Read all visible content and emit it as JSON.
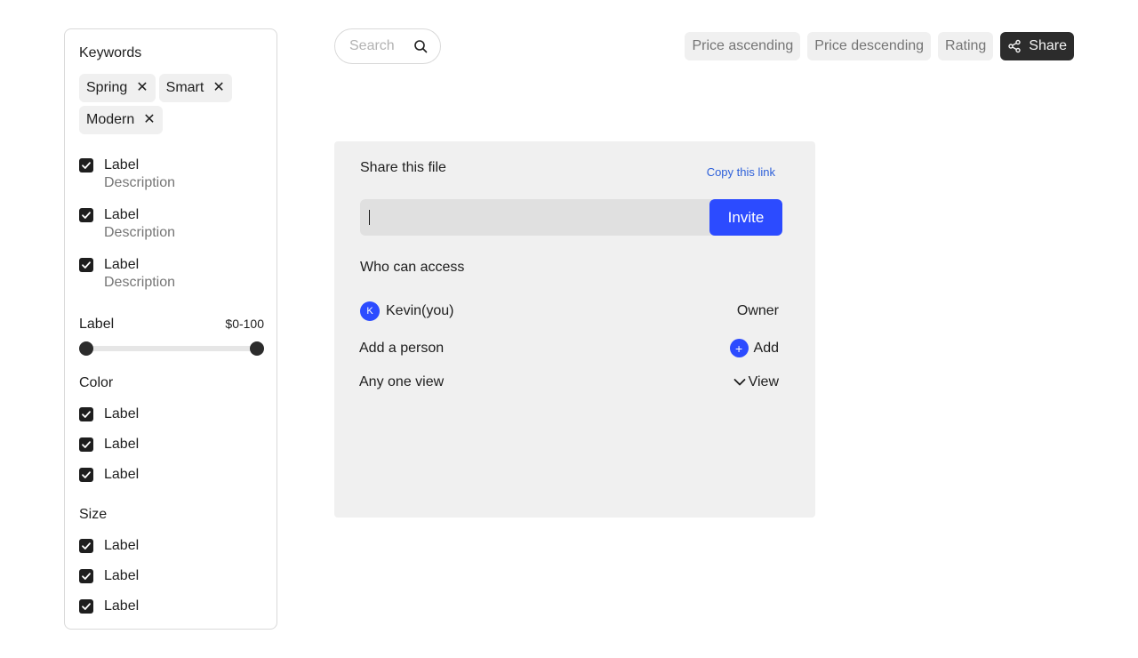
{
  "filters": {
    "keywords_title": "Keywords",
    "keywords": [
      {
        "label": "Spring"
      },
      {
        "label": "Smart"
      },
      {
        "label": "Modern"
      }
    ],
    "checklist": [
      {
        "label": "Label",
        "description": "Description",
        "checked": true
      },
      {
        "label": "Label",
        "description": "Description",
        "checked": true
      },
      {
        "label": "Label",
        "description": "Description",
        "checked": true
      }
    ],
    "range": {
      "label": "Label",
      "value_text": "$0-100",
      "min": 0,
      "max": 100
    },
    "color": {
      "title": "Color",
      "items": [
        {
          "label": "Label",
          "checked": true
        },
        {
          "label": "Label",
          "checked": true
        },
        {
          "label": "Label",
          "checked": true
        }
      ]
    },
    "size": {
      "title": "Size",
      "items": [
        {
          "label": "Label",
          "checked": true
        },
        {
          "label": "Label",
          "checked": true
        },
        {
          "label": "Label",
          "checked": true
        }
      ]
    }
  },
  "toolbar": {
    "search_placeholder": "Search",
    "sort_buttons": [
      "Price ascending",
      "Price descending",
      "Rating"
    ],
    "share_label": "Share"
  },
  "share_dialog": {
    "title": "Share this file",
    "copy_link": "Copy this link",
    "input_value": "",
    "invite_label": "Invite",
    "access_title": "Who can access",
    "owner": {
      "initial": "K",
      "name": "Kevin(you)",
      "role": "Owner"
    },
    "add_person": {
      "label": "Add a person",
      "action": "Add"
    },
    "general_access": {
      "label": "Any one view",
      "permission": "View"
    }
  },
  "colors": {
    "accent": "#2C4BFF",
    "link": "#2C5FD9",
    "dark": "#2C2C2C",
    "panel": "#F0F0F0"
  }
}
